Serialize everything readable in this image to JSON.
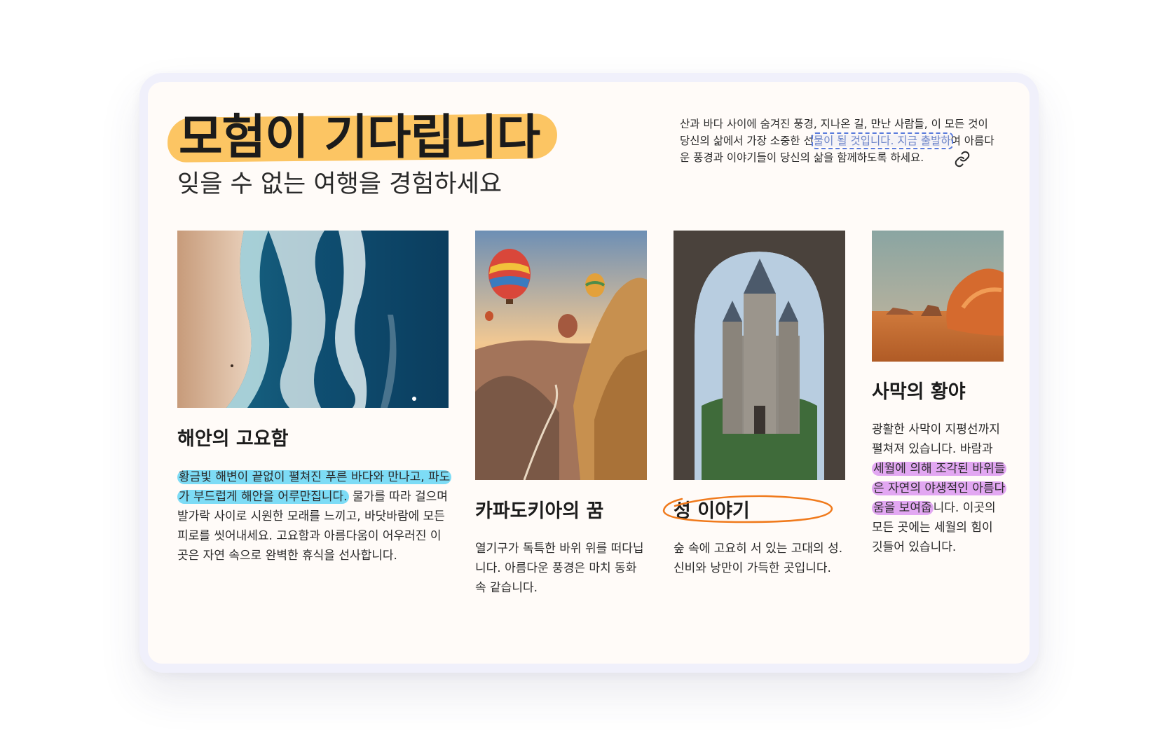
{
  "header": {
    "title": "모험이 기다립니다",
    "subtitle": "잊을 수 없는 여행을 경험하세요",
    "intro_before": "산과 바다 사이에 숨겨진 풍경, 지나온 길, 만난 사람들, 이 모든 것이 당신의 삶에서 가장 소중한 선",
    "intro_selected": "물이 될 것입니다. 지금 출발하",
    "intro_after": "여 아름다운 풍경과 이야기들이 당신의 삶을 함께하도록 하세요."
  },
  "cards": [
    {
      "title": "해안의 고요함",
      "highlight": "황금빛 해변이 끝없이 펼쳐진 푸른 바다와 만나고, 파도가 부드럽게 해안을 어루만집니다.",
      "text": " 물가를 따라 걸으며 발가락 사이로 시원한 모래를 느끼고, 바닷바람에 모든 피로를 씻어내세요. 고요함과 아름다움이 어우러진 이곳은 자연 속으로 완벽한 휴식을 선사합니다."
    },
    {
      "title": "카파도키아의 꿈",
      "text": "열기구가 독특한 바위 위를 떠다닙니다. 아름다운 풍경은 마치 동화 속 같습니다."
    },
    {
      "title": "성 이야기",
      "text": "숲 속에 고요히 서 있는 고대의 성. 신비와 낭만이 가득한 곳입니다."
    },
    {
      "title": "사막의 황야",
      "text_before": "광활한 사막이 지평선까지 펼쳐져 있습니다. 바람과 ",
      "highlight": "세월에 의해 조각된 바위들은 자연의 야생적인 아름다움을 보여줍",
      "text_after": "니다. 이곳의 모든 곳에는 세월의 힘이 깃들어 있습니다."
    }
  ],
  "colors": {
    "title_highlight": "#fcc563",
    "blue_highlight": "#7ddcf6",
    "violet_highlight": "#e2a7f2",
    "circle_annotation": "#f07a1c",
    "selection_outline": "#5a7bdc"
  },
  "icons": {
    "link": "link-icon"
  }
}
